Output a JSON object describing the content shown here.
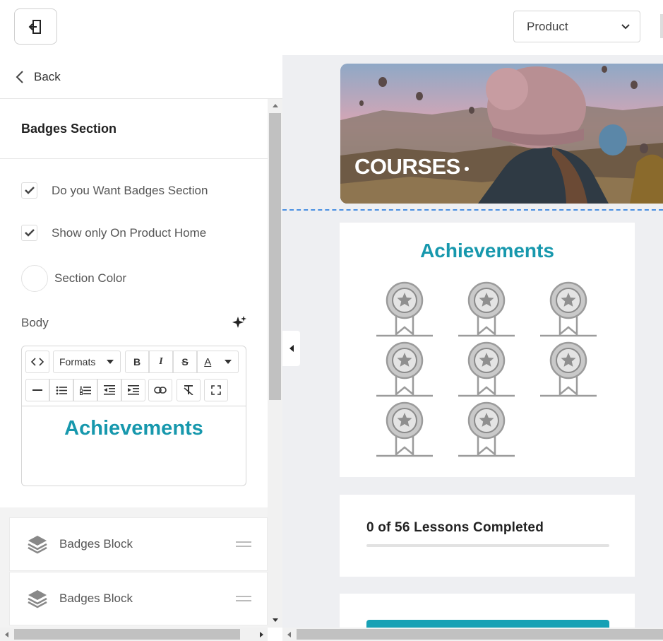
{
  "toolbar": {
    "exit_icon": "exit-icon",
    "view_select": {
      "value": "Product",
      "options": [
        "Product"
      ]
    }
  },
  "sidebar": {
    "back_label": "Back",
    "section_title": "Badges Section",
    "options": {
      "want_badges": {
        "label": "Do you Want Badges Section",
        "checked": true
      },
      "product_home_only": {
        "label": "Show only On Product Home",
        "checked": true
      },
      "section_color": {
        "label": "Section Color",
        "value": "#ffffff"
      }
    },
    "body_label": "Body",
    "ai_icon": "sparkle-icon",
    "editor": {
      "toolbar_row1": [
        "code",
        "Formats",
        "B",
        "I",
        "S",
        "A"
      ],
      "toolbar_row2": [
        "horizontal-rule",
        "bullet-list",
        "numbered-list",
        "outdent",
        "indent",
        "link",
        "clear-format",
        "fullscreen"
      ],
      "content": "Achievements"
    },
    "blocks": [
      {
        "label": "Badges Block",
        "icon": "layers-icon"
      },
      {
        "label": "Badges Block",
        "icon": "layers-icon"
      }
    ]
  },
  "preview": {
    "banner_title": "COURSES",
    "achievements_title": "Achievements",
    "badge_count": 8,
    "lessons_text": "0 of 56 Lessons Completed",
    "progress": 0
  },
  "colors": {
    "accent": "#1798ad",
    "button": "#17a1b5",
    "selection_dash": "#4a90e2"
  }
}
